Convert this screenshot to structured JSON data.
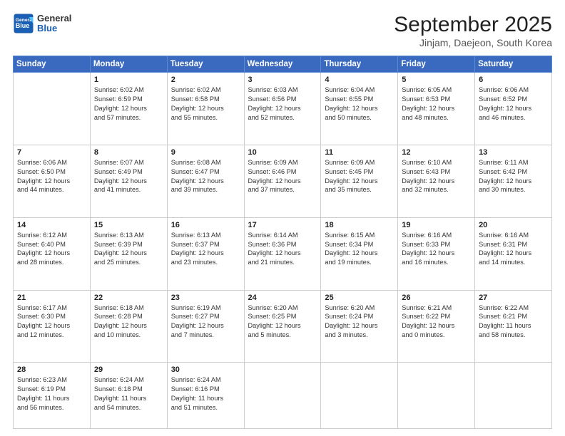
{
  "header": {
    "logo_general": "General",
    "logo_blue": "Blue",
    "month_title": "September 2025",
    "location": "Jinjam, Daejeon, South Korea"
  },
  "days_of_week": [
    "Sunday",
    "Monday",
    "Tuesday",
    "Wednesday",
    "Thursday",
    "Friday",
    "Saturday"
  ],
  "weeks": [
    [
      {
        "day": "",
        "info": ""
      },
      {
        "day": "1",
        "info": "Sunrise: 6:02 AM\nSunset: 6:59 PM\nDaylight: 12 hours\nand 57 minutes."
      },
      {
        "day": "2",
        "info": "Sunrise: 6:02 AM\nSunset: 6:58 PM\nDaylight: 12 hours\nand 55 minutes."
      },
      {
        "day": "3",
        "info": "Sunrise: 6:03 AM\nSunset: 6:56 PM\nDaylight: 12 hours\nand 52 minutes."
      },
      {
        "day": "4",
        "info": "Sunrise: 6:04 AM\nSunset: 6:55 PM\nDaylight: 12 hours\nand 50 minutes."
      },
      {
        "day": "5",
        "info": "Sunrise: 6:05 AM\nSunset: 6:53 PM\nDaylight: 12 hours\nand 48 minutes."
      },
      {
        "day": "6",
        "info": "Sunrise: 6:06 AM\nSunset: 6:52 PM\nDaylight: 12 hours\nand 46 minutes."
      }
    ],
    [
      {
        "day": "7",
        "info": "Sunrise: 6:06 AM\nSunset: 6:50 PM\nDaylight: 12 hours\nand 44 minutes."
      },
      {
        "day": "8",
        "info": "Sunrise: 6:07 AM\nSunset: 6:49 PM\nDaylight: 12 hours\nand 41 minutes."
      },
      {
        "day": "9",
        "info": "Sunrise: 6:08 AM\nSunset: 6:47 PM\nDaylight: 12 hours\nand 39 minutes."
      },
      {
        "day": "10",
        "info": "Sunrise: 6:09 AM\nSunset: 6:46 PM\nDaylight: 12 hours\nand 37 minutes."
      },
      {
        "day": "11",
        "info": "Sunrise: 6:09 AM\nSunset: 6:45 PM\nDaylight: 12 hours\nand 35 minutes."
      },
      {
        "day": "12",
        "info": "Sunrise: 6:10 AM\nSunset: 6:43 PM\nDaylight: 12 hours\nand 32 minutes."
      },
      {
        "day": "13",
        "info": "Sunrise: 6:11 AM\nSunset: 6:42 PM\nDaylight: 12 hours\nand 30 minutes."
      }
    ],
    [
      {
        "day": "14",
        "info": "Sunrise: 6:12 AM\nSunset: 6:40 PM\nDaylight: 12 hours\nand 28 minutes."
      },
      {
        "day": "15",
        "info": "Sunrise: 6:13 AM\nSunset: 6:39 PM\nDaylight: 12 hours\nand 25 minutes."
      },
      {
        "day": "16",
        "info": "Sunrise: 6:13 AM\nSunset: 6:37 PM\nDaylight: 12 hours\nand 23 minutes."
      },
      {
        "day": "17",
        "info": "Sunrise: 6:14 AM\nSunset: 6:36 PM\nDaylight: 12 hours\nand 21 minutes."
      },
      {
        "day": "18",
        "info": "Sunrise: 6:15 AM\nSunset: 6:34 PM\nDaylight: 12 hours\nand 19 minutes."
      },
      {
        "day": "19",
        "info": "Sunrise: 6:16 AM\nSunset: 6:33 PM\nDaylight: 12 hours\nand 16 minutes."
      },
      {
        "day": "20",
        "info": "Sunrise: 6:16 AM\nSunset: 6:31 PM\nDaylight: 12 hours\nand 14 minutes."
      }
    ],
    [
      {
        "day": "21",
        "info": "Sunrise: 6:17 AM\nSunset: 6:30 PM\nDaylight: 12 hours\nand 12 minutes."
      },
      {
        "day": "22",
        "info": "Sunrise: 6:18 AM\nSunset: 6:28 PM\nDaylight: 12 hours\nand 10 minutes."
      },
      {
        "day": "23",
        "info": "Sunrise: 6:19 AM\nSunset: 6:27 PM\nDaylight: 12 hours\nand 7 minutes."
      },
      {
        "day": "24",
        "info": "Sunrise: 6:20 AM\nSunset: 6:25 PM\nDaylight: 12 hours\nand 5 minutes."
      },
      {
        "day": "25",
        "info": "Sunrise: 6:20 AM\nSunset: 6:24 PM\nDaylight: 12 hours\nand 3 minutes."
      },
      {
        "day": "26",
        "info": "Sunrise: 6:21 AM\nSunset: 6:22 PM\nDaylight: 12 hours\nand 0 minutes."
      },
      {
        "day": "27",
        "info": "Sunrise: 6:22 AM\nSunset: 6:21 PM\nDaylight: 11 hours\nand 58 minutes."
      }
    ],
    [
      {
        "day": "28",
        "info": "Sunrise: 6:23 AM\nSunset: 6:19 PM\nDaylight: 11 hours\nand 56 minutes."
      },
      {
        "day": "29",
        "info": "Sunrise: 6:24 AM\nSunset: 6:18 PM\nDaylight: 11 hours\nand 54 minutes."
      },
      {
        "day": "30",
        "info": "Sunrise: 6:24 AM\nSunset: 6:16 PM\nDaylight: 11 hours\nand 51 minutes."
      },
      {
        "day": "",
        "info": ""
      },
      {
        "day": "",
        "info": ""
      },
      {
        "day": "",
        "info": ""
      },
      {
        "day": "",
        "info": ""
      }
    ]
  ]
}
